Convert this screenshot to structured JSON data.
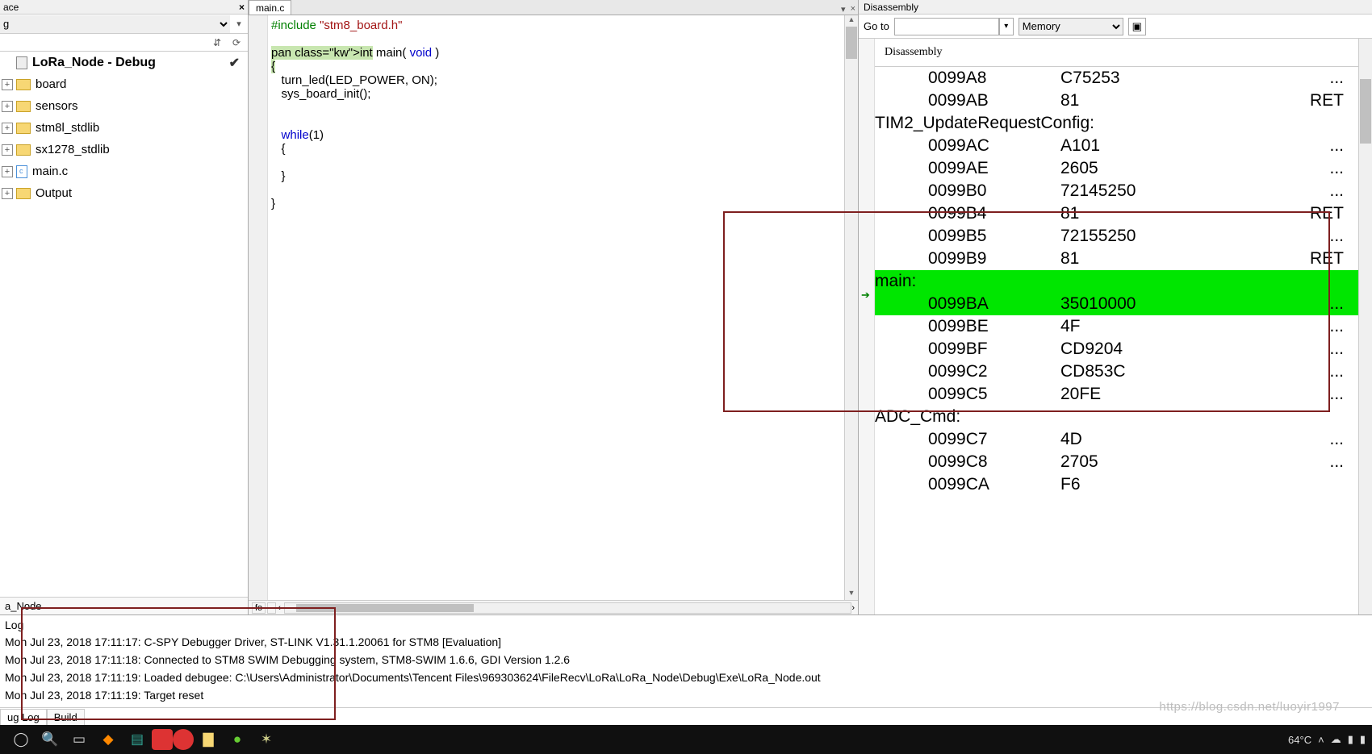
{
  "workspace": {
    "title_fragment": "ace",
    "combo_fragment": "g",
    "project": "LoRa_Node - Debug",
    "items": [
      {
        "label": "board",
        "type": "folder"
      },
      {
        "label": "sensors",
        "type": "folder"
      },
      {
        "label": "stm8l_stdlib",
        "type": "folder"
      },
      {
        "label": "sx1278_stdlib",
        "type": "folder"
      },
      {
        "label": "main.c",
        "type": "cfile"
      },
      {
        "label": "Output",
        "type": "folder"
      }
    ],
    "bottom_tab": "a_Node"
  },
  "editor": {
    "tab": "main.c",
    "code_lines": [
      {
        "t": "#include \"stm8_board.h\"",
        "cls": "pp"
      },
      {
        "t": "",
        "cls": ""
      },
      {
        "t": "int main( void )",
        "cls": "sig",
        "mark": true
      },
      {
        "t": "{",
        "cls": "",
        "mark": true
      },
      {
        "t": "   turn_led(LED_POWER, ON);",
        "cls": ""
      },
      {
        "t": "   sys_board_init();",
        "cls": ""
      },
      {
        "t": "",
        "cls": ""
      },
      {
        "t": "",
        "cls": ""
      },
      {
        "t": "   while(1)",
        "cls": "wh"
      },
      {
        "t": "   {",
        "cls": ""
      },
      {
        "t": "",
        "cls": ""
      },
      {
        "t": "   }",
        "cls": ""
      },
      {
        "t": "",
        "cls": ""
      },
      {
        "t": "}",
        "cls": ""
      }
    ]
  },
  "disasm": {
    "title": "Disassembly",
    "goto_label": "Go to",
    "goto_value": "",
    "memory_label": "Memory",
    "list_header": "Disassembly",
    "rows": [
      {
        "addr": "0099A8",
        "bytes": "C75253",
        "mn": "..."
      },
      {
        "addr": "0099AB",
        "bytes": "81",
        "mn": "RET"
      },
      {
        "label": "TIM2_UpdateRequestConfig:"
      },
      {
        "addr": "0099AC",
        "bytes": "A101",
        "mn": "..."
      },
      {
        "addr": "0099AE",
        "bytes": "2605",
        "mn": "..."
      },
      {
        "addr": "0099B0",
        "bytes": "72145250",
        "mn": "..."
      },
      {
        "addr": "0099B4",
        "bytes": "81",
        "mn": "RET"
      },
      {
        "addr": "0099B5",
        "bytes": "72155250",
        "mn": "..."
      },
      {
        "addr": "0099B9",
        "bytes": "81",
        "mn": "RET"
      },
      {
        "label": "main:",
        "hl": true
      },
      {
        "addr": "0099BA",
        "bytes": "35010000",
        "mn": "...",
        "hl": true,
        "arrow": true
      },
      {
        "addr": "0099BE",
        "bytes": "4F",
        "mn": "..."
      },
      {
        "addr": "0099BF",
        "bytes": "CD9204",
        "mn": "..."
      },
      {
        "addr": "0099C2",
        "bytes": "CD853C",
        "mn": "..."
      },
      {
        "addr": "0099C5",
        "bytes": "20FE",
        "mn": "..."
      },
      {
        "label": "ADC_Cmd:"
      },
      {
        "addr": "0099C7",
        "bytes": "4D",
        "mn": "..."
      },
      {
        "addr": "0099C8",
        "bytes": "2705",
        "mn": "..."
      },
      {
        "addr": "0099CA",
        "bytes": "F6",
        "mn": ""
      }
    ]
  },
  "log": {
    "header": "Log",
    "lines": [
      "Mon Jul 23, 2018 17:11:17: C-SPY Debugger Driver, ST-LINK V1.31.1.20061 for STM8 [Evaluation]",
      "Mon Jul 23, 2018 17:11:18: Connected to STM8 SWIM Debugging system, STM8-SWIM 1.6.6, GDI Version 1.2.6",
      "Mon Jul 23, 2018 17:11:19: Loaded debugee: C:\\Users\\Administrator\\Documents\\Tencent Files\\969303624\\FileRecv\\LoRa\\LoRa_Node\\Debug\\Exe\\LoRa_Node.out",
      "Mon Jul 23, 2018 17:11:19: Target reset"
    ],
    "tabs": [
      "ug Log",
      "Build"
    ]
  },
  "taskbar": {
    "temp": "64°C",
    "watermark": "https://blog.csdn.net/luoyir1997"
  }
}
